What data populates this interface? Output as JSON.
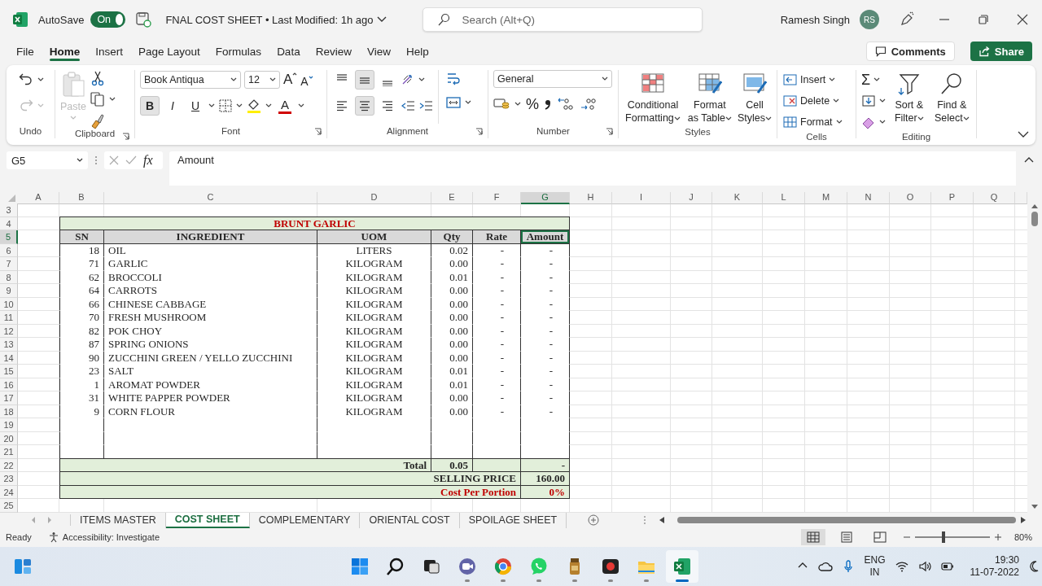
{
  "title_bar": {
    "autosave_label": "AutoSave",
    "autosave": {
      "label": "On",
      "on": true
    },
    "document_title": "FNAL COST SHEET • Last Modified: 1h ago",
    "search_placeholder": "Search (Alt+Q)",
    "user_name": "Ramesh Singh",
    "avatar_initials": "RS"
  },
  "menu_tabs": [
    {
      "label": "File",
      "selected": false
    },
    {
      "label": "Home",
      "selected": true
    },
    {
      "label": "Insert",
      "selected": false
    },
    {
      "label": "Page Layout",
      "selected": false
    },
    {
      "label": "Formulas",
      "selected": false
    },
    {
      "label": "Data",
      "selected": false
    },
    {
      "label": "Review",
      "selected": false
    },
    {
      "label": "View",
      "selected": false
    },
    {
      "label": "Help",
      "selected": false
    }
  ],
  "comments_button": "Comments",
  "share_button": "Share",
  "ribbon": {
    "undo": {
      "label": "Undo",
      "redo": {
        "disabled": true
      }
    },
    "clipboard": {
      "label": "Clipboard",
      "paste": {
        "label": "Paste",
        "disabled": true
      }
    },
    "font": {
      "label": "Font",
      "font_name": "Book Antiqua",
      "font_size": "12",
      "grow": "A",
      "shrink": "A",
      "bold": {
        "label": "B",
        "selected": true
      },
      "italic": {
        "label": "I",
        "selected": false
      },
      "underline": {
        "label": "U",
        "selected": false
      },
      "font_color": "A"
    },
    "alignment": {
      "label": "Alignment",
      "vertical": [
        {
          "selected": false
        },
        {
          "selected": true
        },
        {
          "selected": false
        }
      ],
      "horizontal": [
        {
          "selected": false
        },
        {
          "selected": true
        },
        {
          "selected": false
        }
      ]
    },
    "number": {
      "label": "Number",
      "format": "General",
      "percent": "%"
    },
    "styles": {
      "label": "Styles",
      "buttons": [
        "Conditional Formatting",
        "Format as Table",
        "Cell Styles"
      ]
    },
    "cells": {
      "label": "Cells",
      "buttons": [
        "Insert",
        "Delete",
        "Format"
      ]
    },
    "editing": {
      "label": "Editing",
      "autosum": "Σ",
      "buttons": [
        "Sort & Filter",
        "Find & Select"
      ]
    }
  },
  "formula_bar": {
    "name_box": "G5",
    "function_label": "fx",
    "formula": "Amount"
  },
  "sheet": {
    "columns": [
      {
        "label": "A",
        "selected": false
      },
      {
        "label": "B",
        "selected": false
      },
      {
        "label": "C",
        "selected": false
      },
      {
        "label": "D",
        "selected": false
      },
      {
        "label": "E",
        "selected": false
      },
      {
        "label": "F",
        "selected": false
      },
      {
        "label": "G",
        "selected": true
      },
      {
        "label": "H",
        "selected": false
      },
      {
        "label": "I",
        "selected": false
      },
      {
        "label": "J",
        "selected": false
      },
      {
        "label": "K",
        "selected": false
      },
      {
        "label": "L",
        "selected": false
      },
      {
        "label": "M",
        "selected": false
      },
      {
        "label": "N",
        "selected": false
      },
      {
        "label": "O",
        "selected": false
      },
      {
        "label": "P",
        "selected": false
      },
      {
        "label": "Q",
        "selected": false
      }
    ],
    "rows": [
      {
        "number": "3",
        "selected": false,
        "kind": "blank"
      },
      {
        "number": "4",
        "selected": false,
        "kind": "title",
        "cells": [
          "BRUNT GARLIC"
        ]
      },
      {
        "number": "5",
        "selected": true,
        "kind": "header",
        "cells": [
          "SN",
          "INGREDIENT",
          "UOM",
          "Qty",
          "Rate",
          "Amount"
        ]
      },
      {
        "number": "6",
        "selected": false,
        "kind": "item",
        "cells": [
          "18",
          "OIL",
          "LITERS",
          "0.02",
          "-",
          "-"
        ]
      },
      {
        "number": "7",
        "selected": false,
        "kind": "item",
        "cells": [
          "71",
          "GARLIC",
          "KILOGRAM",
          "0.00",
          "-",
          "-"
        ]
      },
      {
        "number": "8",
        "selected": false,
        "kind": "item",
        "cells": [
          "62",
          "BROCCOLI",
          "KILOGRAM",
          "0.01",
          "-",
          "-"
        ]
      },
      {
        "number": "9",
        "selected": false,
        "kind": "item",
        "cells": [
          "64",
          "CARROTS",
          "KILOGRAM",
          "0.00",
          "-",
          "-"
        ]
      },
      {
        "number": "10",
        "selected": false,
        "kind": "item",
        "cells": [
          "66",
          "CHINESE CABBAGE",
          "KILOGRAM",
          "0.00",
          "-",
          "-"
        ]
      },
      {
        "number": "11",
        "selected": false,
        "kind": "item",
        "cells": [
          "70",
          "FRESH MUSHROOM",
          "KILOGRAM",
          "0.00",
          "-",
          "-"
        ]
      },
      {
        "number": "12",
        "selected": false,
        "kind": "item",
        "cells": [
          "82",
          "POK CHOY",
          "KILOGRAM",
          "0.00",
          "-",
          "-"
        ]
      },
      {
        "number": "13",
        "selected": false,
        "kind": "item",
        "cells": [
          "87",
          "SPRING ONIONS",
          "KILOGRAM",
          "0.00",
          "-",
          "-"
        ]
      },
      {
        "number": "14",
        "selected": false,
        "kind": "item",
        "cells": [
          "90",
          "ZUCCHINI GREEN / YELLO ZUCCHINI",
          "KILOGRAM",
          "0.00",
          "-",
          "-"
        ]
      },
      {
        "number": "15",
        "selected": false,
        "kind": "item",
        "cells": [
          "23",
          "SALT",
          "KILOGRAM",
          "0.01",
          "-",
          "-"
        ]
      },
      {
        "number": "16",
        "selected": false,
        "kind": "item",
        "cells": [
          "1",
          "AROMAT POWDER",
          "KILOGRAM",
          "0.01",
          "-",
          "-"
        ]
      },
      {
        "number": "17",
        "selected": false,
        "kind": "item",
        "cells": [
          "31",
          "WHITE PAPPER POWDER",
          "KILOGRAM",
          "0.00",
          "-",
          "-"
        ]
      },
      {
        "number": "18",
        "selected": false,
        "kind": "item",
        "cells": [
          "9",
          "CORN FLOUR",
          "KILOGRAM",
          "0.00",
          "-",
          "-"
        ]
      },
      {
        "number": "19",
        "selected": false,
        "kind": "empty_item"
      },
      {
        "number": "20",
        "selected": false,
        "kind": "empty_item"
      },
      {
        "number": "21",
        "selected": false,
        "kind": "empty_item"
      },
      {
        "number": "22",
        "selected": false,
        "kind": "total",
        "cells": [
          "Total",
          "0.05",
          "-"
        ]
      },
      {
        "number": "23",
        "selected": false,
        "kind": "selling",
        "cells": [
          "SELLING PRICE",
          "160.00"
        ]
      },
      {
        "number": "24",
        "selected": false,
        "kind": "portion",
        "cells": [
          "Cost Per Portion",
          "0%"
        ]
      },
      {
        "number": "25",
        "selected": false,
        "kind": "blank"
      }
    ]
  },
  "sheet_tabs": [
    {
      "label": "ITEMS MASTER",
      "selected": false
    },
    {
      "label": "COST SHEET",
      "selected": true
    },
    {
      "label": "COMPLEMENTARY",
      "selected": false
    },
    {
      "label": "ORIENTAL COST",
      "selected": false
    },
    {
      "label": "SPOILAGE SHEET",
      "selected": false
    }
  ],
  "status_bar": {
    "status": "Ready",
    "accessibility": "Accessibility: Investigate",
    "views": [
      {
        "selected": true
      },
      {
        "selected": false
      },
      {
        "selected": false
      }
    ],
    "zoom": {
      "level": 0.38
    },
    "zoom_label": "80%"
  },
  "taskbar": {
    "apps": [
      {
        "running": false,
        "selected": false
      },
      {
        "running": false,
        "selected": false
      },
      {
        "running": true,
        "selected": false
      },
      {
        "running": true,
        "selected": false
      },
      {
        "running": true,
        "selected": false
      },
      {
        "running": true,
        "selected": false
      },
      {
        "running": true,
        "selected": false
      },
      {
        "running": true,
        "selected": false
      },
      {
        "running": true,
        "selected": true
      }
    ],
    "language": "ENG",
    "region": "IN",
    "time": "19:30",
    "date": "11-07-2022"
  }
}
